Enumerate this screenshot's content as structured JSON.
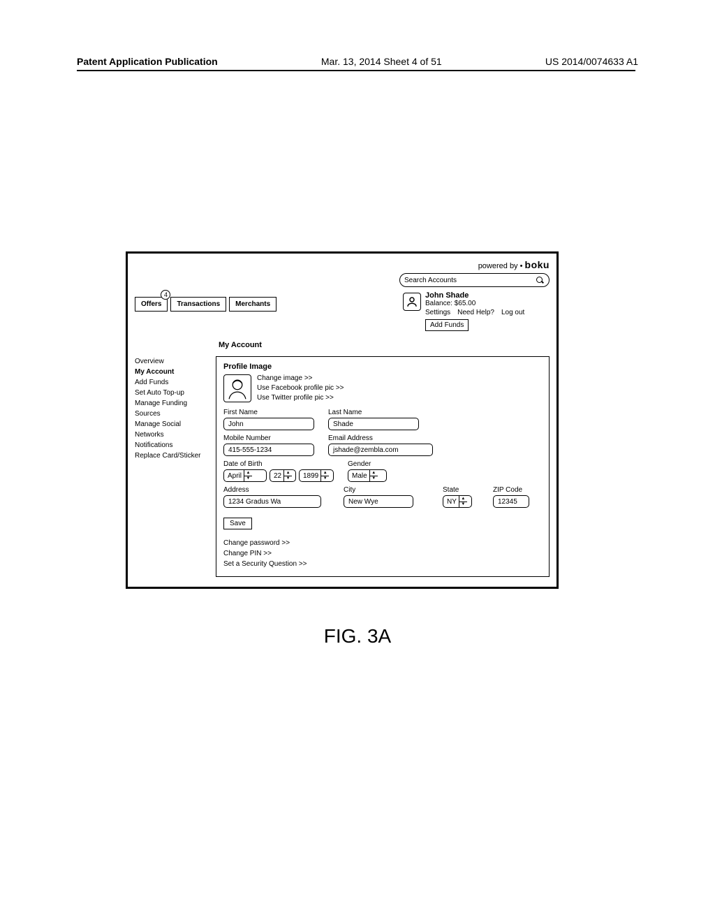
{
  "doc_header": {
    "left": "Patent Application Publication",
    "center": "Mar. 13, 2014  Sheet 4 of 51",
    "right": "US 2014/0074633 A1"
  },
  "powered_by_prefix": "powered by",
  "powered_by_brand": "boku",
  "search": {
    "placeholder": "Search Accounts"
  },
  "tabs": {
    "offers": "Offers",
    "offers_badge": "4",
    "transactions": "Transactions",
    "merchants": "Merchants"
  },
  "user": {
    "name": "John Shade",
    "balance": "Balance: $65.00",
    "settings": "Settings",
    "need_help": "Need Help?",
    "logout": "Log out",
    "add_funds": "Add Funds"
  },
  "section_heading": "My Account",
  "sidebar": {
    "items": [
      "Overview",
      "My Account",
      "Add Funds",
      "Set Auto Top-up",
      "Manage Funding Sources",
      "Manage Social Networks",
      "Notifications",
      "Replace Card/Sticker"
    ],
    "bold_index": 1
  },
  "profile": {
    "title": "Profile Image",
    "change": "Change image >>",
    "fb": "Use Facebook profile pic >>",
    "tw": "Use Twitter profile pic >>"
  },
  "form": {
    "first_name_label": "First Name",
    "first_name": "John",
    "last_name_label": "Last Name",
    "last_name": "Shade",
    "mobile_label": "Mobile Number",
    "mobile": "415-555-1234",
    "email_label": "Email Address",
    "email": "jshade@zembla.com",
    "dob_label": "Date of Birth",
    "dob_month": "April",
    "dob_day": "22",
    "dob_year": "1899",
    "gender_label": "Gender",
    "gender": "Male",
    "address_label": "Address",
    "address": "1234 Gradus Wa",
    "city_label": "City",
    "city": "New Wye",
    "state_label": "State",
    "state": "NY",
    "zip_label": "ZIP Code",
    "zip": "12345",
    "save": "Save"
  },
  "extra": {
    "change_pw": "Change password >>",
    "change_pin": "Change PIN >>",
    "sec_q": "Set a Security Question >>"
  },
  "fig_caption": "FIG. 3A"
}
